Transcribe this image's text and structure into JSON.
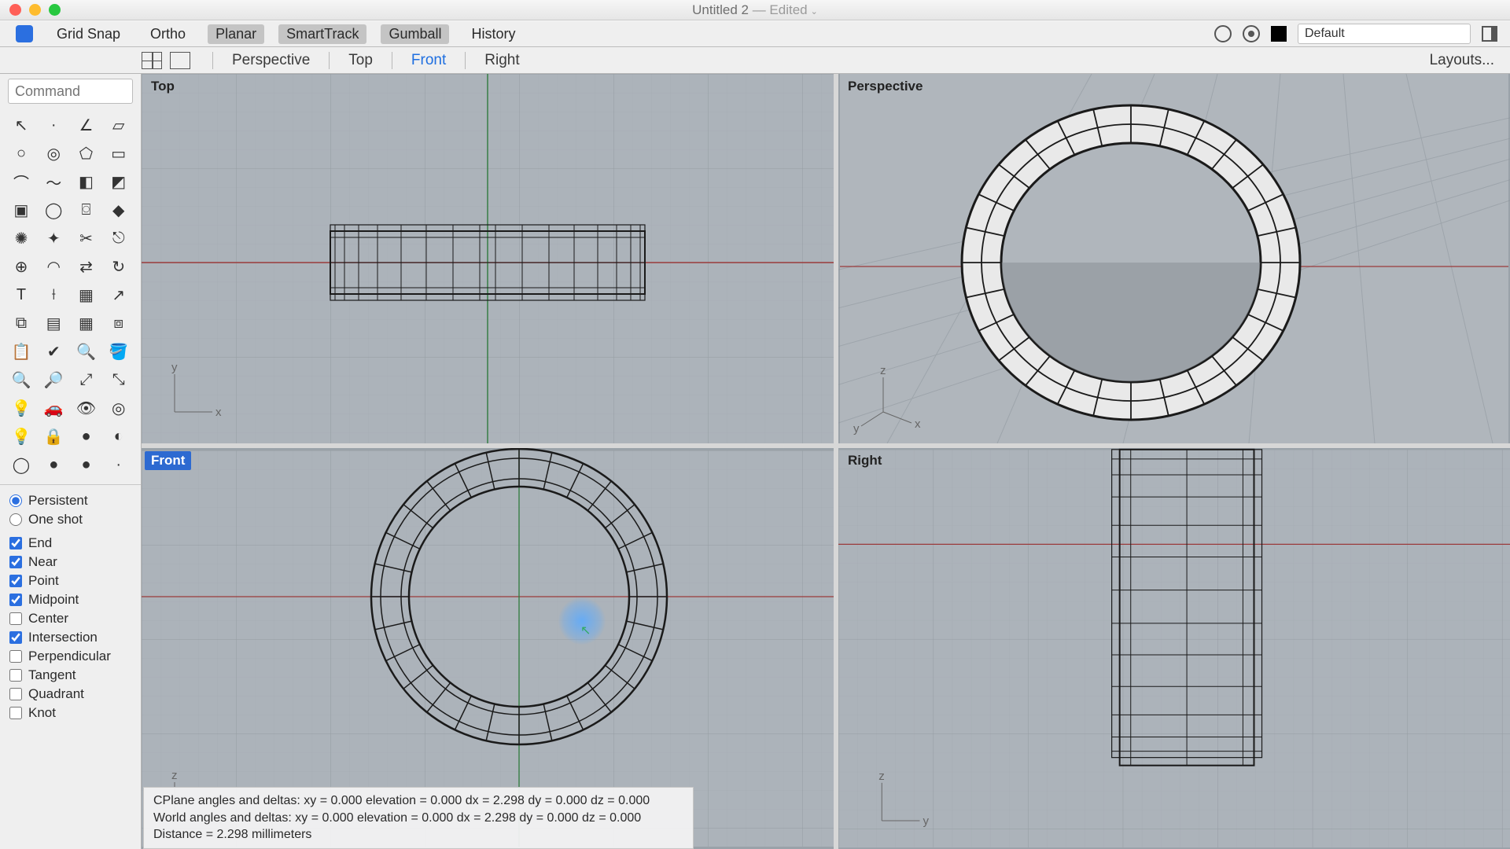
{
  "window": {
    "title": "Untitled 2",
    "edited_suffix": " — Edited"
  },
  "snap_toggles": {
    "grid_snap": "Grid Snap",
    "ortho": "Ortho",
    "planar": "Planar",
    "smart_track": "SmartTrack",
    "gumball": "Gumball",
    "history": "History"
  },
  "snap_active": {
    "planar": true,
    "smart_track": true,
    "gumball": true
  },
  "layer_name": "Default",
  "view_tabs": {
    "items": [
      "Perspective",
      "Top",
      "Front",
      "Right"
    ],
    "active": "Front",
    "layouts_label": "Layouts..."
  },
  "command_placeholder": "Command",
  "tool_names": [
    "select-arrow",
    "point",
    "polyline",
    "rectangle",
    "circle",
    "ellipse",
    "polygon",
    "plane",
    "arc",
    "curve",
    "surface-loft",
    "surface-sweep",
    "box",
    "cylinder",
    "tube",
    "solid",
    "explode",
    "flash",
    "split",
    "join",
    "boolean-union",
    "fillet",
    "mirror",
    "rotate",
    "text",
    "dimension",
    "hatch",
    "leader",
    "group",
    "array",
    "grid-array",
    "ungroup",
    "clipboard",
    "check",
    "inspect",
    "paint",
    "zoom",
    "zoom-window",
    "zoom-extents",
    "zoom-selected",
    "light-bulb",
    "car",
    "eye",
    "target",
    "lightbulb2",
    "lock",
    "material",
    "color-wheel",
    "sphere-wire",
    "sphere-shaded",
    "sphere-render",
    "",
    "transform-origin",
    "",
    "",
    ""
  ],
  "osnap": {
    "mode_persistent": "Persistent",
    "mode_oneshot": "One shot",
    "mode_value": "persistent",
    "options": [
      {
        "label": "End",
        "checked": true
      },
      {
        "label": "Near",
        "checked": true
      },
      {
        "label": "Point",
        "checked": true
      },
      {
        "label": "Midpoint",
        "checked": true
      },
      {
        "label": "Center",
        "checked": false
      },
      {
        "label": "Intersection",
        "checked": true
      },
      {
        "label": "Perpendicular",
        "checked": false
      },
      {
        "label": "Tangent",
        "checked": false
      },
      {
        "label": "Quadrant",
        "checked": false
      },
      {
        "label": "Knot",
        "checked": false
      }
    ]
  },
  "viewports": {
    "top": "Top",
    "perspective": "Perspective",
    "front": "Front",
    "right": "Right",
    "active": "front"
  },
  "status": {
    "line1": "CPlane angles and deltas:  xy = 0.000  elevation = 0.000     dx = 2.298  dy = 0.000  dz = 0.000",
    "line2": "World angles and deltas:    xy = 0.000  elevation = 0.000     dx = 2.298  dy = 0.000  dz = 0.000",
    "line3": "Distance = 2.298 millimeters"
  },
  "axis_labels": {
    "x": "x",
    "y": "y",
    "z": "z"
  }
}
